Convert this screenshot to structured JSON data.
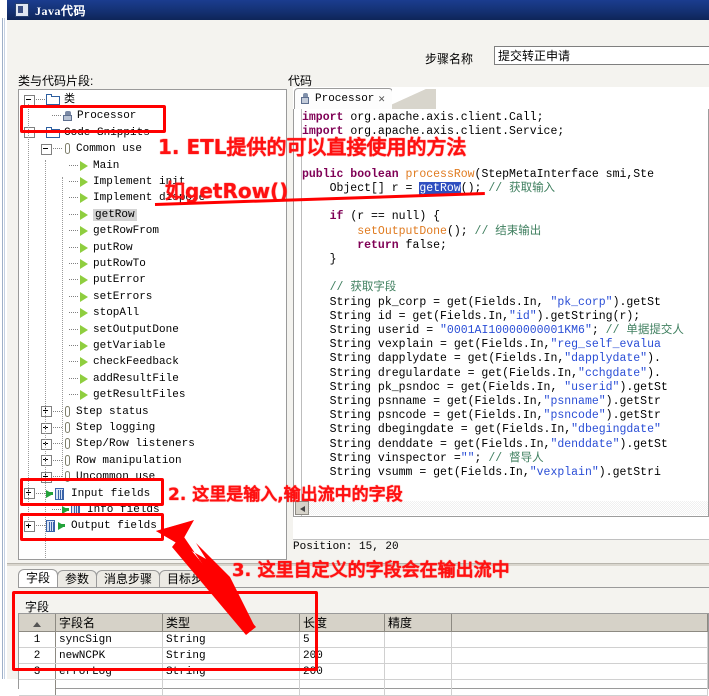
{
  "window": {
    "title": "Java代码",
    "icon": "java-icon"
  },
  "header": {
    "step_name_label": "步骤名称",
    "step_name_value": "提交转正申请"
  },
  "left_panel": {
    "caption": "类与代码片段:",
    "tree": [
      {
        "label": "类",
        "indent": 0,
        "icon": "folder-icon",
        "toggle": "minus"
      },
      {
        "label": "Processor",
        "indent": 1,
        "icon": "class-icon",
        "toggle": "none"
      },
      {
        "label": "Code Snippits",
        "indent": 0,
        "icon": "folder-icon",
        "toggle": "minus"
      },
      {
        "label": "Common use",
        "indent": 1,
        "icon": "clip-icon",
        "toggle": "minus"
      },
      {
        "label": "Main",
        "indent": 2,
        "icon": "triangle-icon",
        "toggle": "none"
      },
      {
        "label": "Implement init",
        "indent": 2,
        "icon": "triangle-icon",
        "toggle": "none"
      },
      {
        "label": "Implement dispose",
        "indent": 2,
        "icon": "triangle-icon",
        "toggle": "none"
      },
      {
        "label": "getRow",
        "indent": 2,
        "icon": "triangle-icon",
        "toggle": "none",
        "selected": true
      },
      {
        "label": "getRowFrom",
        "indent": 2,
        "icon": "triangle-icon",
        "toggle": "none"
      },
      {
        "label": "putRow",
        "indent": 2,
        "icon": "triangle-icon",
        "toggle": "none"
      },
      {
        "label": "putRowTo",
        "indent": 2,
        "icon": "triangle-icon",
        "toggle": "none"
      },
      {
        "label": "putError",
        "indent": 2,
        "icon": "triangle-icon",
        "toggle": "none"
      },
      {
        "label": "setErrors",
        "indent": 2,
        "icon": "triangle-icon",
        "toggle": "none"
      },
      {
        "label": "stopAll",
        "indent": 2,
        "icon": "triangle-icon",
        "toggle": "none"
      },
      {
        "label": "setOutputDone",
        "indent": 2,
        "icon": "triangle-icon",
        "toggle": "none"
      },
      {
        "label": "getVariable",
        "indent": 2,
        "icon": "triangle-icon",
        "toggle": "none"
      },
      {
        "label": "checkFeedback",
        "indent": 2,
        "icon": "triangle-icon",
        "toggle": "none"
      },
      {
        "label": "addResultFile",
        "indent": 2,
        "icon": "triangle-icon",
        "toggle": "none"
      },
      {
        "label": "getResultFiles",
        "indent": 2,
        "icon": "triangle-icon",
        "toggle": "none"
      },
      {
        "label": "Step status",
        "indent": 1,
        "icon": "clip-icon",
        "toggle": "plus"
      },
      {
        "label": "Step logging",
        "indent": 1,
        "icon": "clip-icon",
        "toggle": "plus"
      },
      {
        "label": "Step/Row listeners",
        "indent": 1,
        "icon": "clip-icon",
        "toggle": "plus"
      },
      {
        "label": "Row manipulation",
        "indent": 1,
        "icon": "clip-icon",
        "toggle": "plus"
      },
      {
        "label": "Uncommon use",
        "indent": 1,
        "icon": "clip-icon",
        "toggle": "plus"
      },
      {
        "label": "Input fields",
        "indent": 0,
        "icon": "input-fields-icon",
        "toggle": "plus"
      },
      {
        "label": "Info fields",
        "indent": 1,
        "icon": "input-fields-icon",
        "toggle": "none"
      },
      {
        "label": "Output fields",
        "indent": 0,
        "icon": "output-fields-icon",
        "toggle": "plus"
      }
    ]
  },
  "right_panel": {
    "caption": "代码",
    "tab_label": "Processor",
    "tab_close": "✕",
    "status": "Position: 15, 20",
    "code_lines": [
      {
        "tokens": [
          {
            "t": "import",
            "c": "kw"
          },
          {
            "t": " org.apache.axis.client.Call;",
            "c": ""
          }
        ]
      },
      {
        "tokens": [
          {
            "t": "import",
            "c": "kw"
          },
          {
            "t": " org.apache.axis.client.Service;",
            "c": ""
          }
        ]
      },
      {
        "tokens": []
      },
      {
        "tokens": []
      },
      {
        "tokens": [
          {
            "t": "public boolean ",
            "c": "kw"
          },
          {
            "t": "processRow",
            "c": "mth"
          },
          {
            "t": "(StepMetaInterface smi,Ste",
            "c": ""
          }
        ]
      },
      {
        "tokens": [
          {
            "t": "    Object[] r = ",
            "c": ""
          },
          {
            "t": "getRow",
            "c": "sel-tok"
          },
          {
            "t": "(); ",
            "c": ""
          },
          {
            "t": "// 获取输入",
            "c": "cmt"
          }
        ]
      },
      {
        "tokens": []
      },
      {
        "tokens": [
          {
            "t": "    if",
            "c": "kw"
          },
          {
            "t": " (r == null) {",
            "c": ""
          }
        ]
      },
      {
        "tokens": [
          {
            "t": "        ",
            "c": ""
          },
          {
            "t": "setOutputDone",
            "c": "mth"
          },
          {
            "t": "(); ",
            "c": ""
          },
          {
            "t": "// 结束输出",
            "c": "cmt"
          }
        ]
      },
      {
        "tokens": [
          {
            "t": "        ",
            "c": ""
          },
          {
            "t": "return",
            "c": "kw"
          },
          {
            "t": " false;",
            "c": ""
          }
        ]
      },
      {
        "tokens": [
          {
            "t": "    }",
            "c": ""
          }
        ]
      },
      {
        "tokens": []
      },
      {
        "tokens": [
          {
            "t": "    ",
            "c": ""
          },
          {
            "t": "// 获取字段",
            "c": "cmt"
          }
        ]
      },
      {
        "tokens": [
          {
            "t": "    String pk_corp = get(Fields.In, ",
            "c": ""
          },
          {
            "t": "\"pk_corp\"",
            "c": "str"
          },
          {
            "t": ").getSt",
            "c": ""
          }
        ]
      },
      {
        "tokens": [
          {
            "t": "    String id = get(Fields.In,",
            "c": ""
          },
          {
            "t": "\"id\"",
            "c": "str"
          },
          {
            "t": ").getString(r);",
            "c": ""
          }
        ]
      },
      {
        "tokens": [
          {
            "t": "    String userid = ",
            "c": ""
          },
          {
            "t": "\"0001AI10000000001KM6\"",
            "c": "str"
          },
          {
            "t": "; ",
            "c": ""
          },
          {
            "t": "// 单据提交人",
            "c": "cmt"
          }
        ]
      },
      {
        "tokens": [
          {
            "t": "    String vexplain = get(Fields.In,",
            "c": ""
          },
          {
            "t": "\"reg_self_evalua",
            "c": "str"
          }
        ]
      },
      {
        "tokens": [
          {
            "t": "    String dapplydate = get(Fields.In,",
            "c": ""
          },
          {
            "t": "\"dapplydate\"",
            "c": "str"
          },
          {
            "t": ").",
            "c": ""
          }
        ]
      },
      {
        "tokens": [
          {
            "t": "    String dregulardate = get(Fields.In,",
            "c": ""
          },
          {
            "t": "\"cchgdate\"",
            "c": "str"
          },
          {
            "t": ").",
            "c": ""
          }
        ]
      },
      {
        "tokens": [
          {
            "t": "    String pk_psndoc = get(Fields.In, ",
            "c": ""
          },
          {
            "t": "\"userid\"",
            "c": "str"
          },
          {
            "t": ").getSt",
            "c": ""
          }
        ]
      },
      {
        "tokens": [
          {
            "t": "    String psnname = get(Fields.In,",
            "c": ""
          },
          {
            "t": "\"psnname\"",
            "c": "str"
          },
          {
            "t": ").getStr",
            "c": ""
          }
        ]
      },
      {
        "tokens": [
          {
            "t": "    String psncode = get(Fields.In,",
            "c": ""
          },
          {
            "t": "\"psncode\"",
            "c": "str"
          },
          {
            "t": ").getStr",
            "c": ""
          }
        ]
      },
      {
        "tokens": [
          {
            "t": "    String dbegingdate = get(Fields.In,",
            "c": ""
          },
          {
            "t": "\"dbegingdate\"",
            "c": "str"
          }
        ]
      },
      {
        "tokens": [
          {
            "t": "    String denddate = get(Fields.In,",
            "c": ""
          },
          {
            "t": "\"denddate\"",
            "c": "str"
          },
          {
            "t": ").getSt",
            "c": ""
          }
        ]
      },
      {
        "tokens": [
          {
            "t": "    String vinspector =",
            "c": ""
          },
          {
            "t": "\"\"",
            "c": "str"
          },
          {
            "t": "; ",
            "c": ""
          },
          {
            "t": "// 督导人",
            "c": "cmt"
          }
        ]
      },
      {
        "tokens": [
          {
            "t": "    String vsumm = get(Fields.In,",
            "c": ""
          },
          {
            "t": "\"vexplain\"",
            "c": "str"
          },
          {
            "t": ").getStri",
            "c": ""
          }
        ]
      }
    ]
  },
  "bottom": {
    "tabs": [
      {
        "label": "字段",
        "active": true
      },
      {
        "label": "参数",
        "active": false
      },
      {
        "label": "消息步骤",
        "active": false
      },
      {
        "label": "目标步骤",
        "active": false
      }
    ],
    "fields_caption": "字段",
    "grid": {
      "columns": [
        "字段名",
        "类型",
        "长度",
        "精度",
        ""
      ],
      "rows": [
        {
          "n": "1",
          "name": "syncSign",
          "type": "String",
          "length": "5",
          "precision": ""
        },
        {
          "n": "2",
          "name": "newNCPK",
          "type": "String",
          "length": "200",
          "precision": ""
        },
        {
          "n": "3",
          "name": "errorLog",
          "type": "String",
          "length": "200",
          "precision": ""
        },
        {
          "n": "",
          "name": "",
          "type": "",
          "length": "",
          "precision": ""
        }
      ]
    }
  },
  "annotations": [
    {
      "id": "a1",
      "text": "1. ETL提供的可以直接使用的方法"
    },
    {
      "id": "a1b",
      "text": "如getRow()"
    },
    {
      "id": "a2",
      "text": "2. 这里是输入,输出流中的字段"
    },
    {
      "id": "a3",
      "text": "3. 这里自定义的字段会在输出流中"
    }
  ],
  "colors": {
    "annotation_red": "#ff0000",
    "titlebar_blue": "#143173",
    "keyword": "#7f0055",
    "string": "#2a4ed6",
    "comment": "#3f7f5f",
    "method": "#e07b20"
  }
}
